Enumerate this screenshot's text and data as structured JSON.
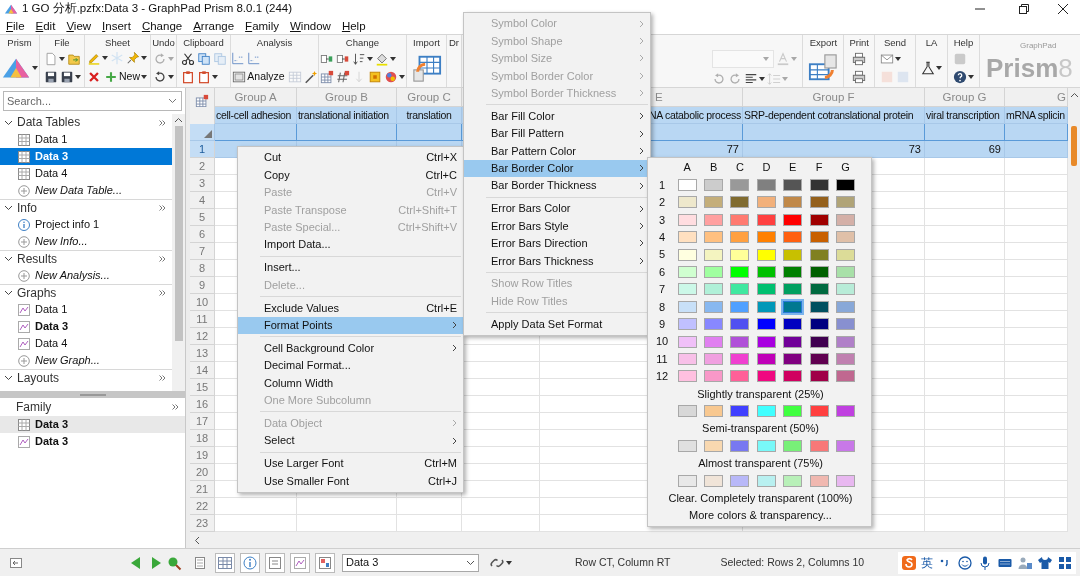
{
  "window": {
    "title": "1 GO 分析.pzfx:Data 3 - GraphPad Prism 8.0.1 (244)"
  },
  "menu_bar": [
    "File",
    "Edit",
    "View",
    "Insert",
    "Change",
    "Arrange",
    "Family",
    "Window",
    "Help"
  ],
  "ribbon": {
    "left": [
      {
        "label": "Prism",
        "rows": [
          [
            {
              "kind": "prism",
              "disabled": false,
              "has_menu": true
            }
          ]
        ]
      },
      {
        "label": "File",
        "rows": [
          [
            {
              "kind": "doc",
              "disabled": false,
              "has_menu": true
            },
            {
              "kind": "open",
              "disabled": false
            }
          ],
          [
            {
              "kind": "save",
              "disabled": false
            },
            {
              "kind": "save",
              "disabled": false,
              "has_menu": true
            }
          ]
        ]
      },
      {
        "label": "Sheet",
        "rows": [
          [
            {
              "kind": "pen",
              "disabled": false,
              "has_menu": true
            },
            {
              "kind": "snowflake",
              "disabled": true
            },
            {
              "kind": "pin",
              "disabled": false,
              "has_menu": true
            }
          ],
          [
            {
              "kind": "cross",
              "disabled": false
            },
            {
              "kind": "plus",
              "label": "New",
              "disabled": false,
              "has_menu": true
            }
          ]
        ]
      },
      {
        "label": "Undo",
        "rows": [
          [
            {
              "kind": "redo",
              "disabled": true,
              "has_menu": true
            }
          ],
          [
            {
              "kind": "undo",
              "disabled": false,
              "has_menu": true
            }
          ]
        ]
      },
      {
        "label": "Clipboard",
        "rows": [
          [
            {
              "kind": "scissors",
              "disabled": false
            },
            {
              "kind": "copy",
              "disabled": false
            },
            {
              "kind": "copy",
              "disabled": true
            }
          ],
          [
            {
              "kind": "clipboard",
              "disabled": false
            },
            {
              "kind": "clipboard",
              "disabled": false,
              "has_menu": true
            }
          ]
        ]
      },
      {
        "label": "Analysis",
        "rows": [
          [
            {
              "kind": "chartdash",
              "disabled": false
            },
            {
              "kind": "chartdash",
              "disabled": false
            }
          ],
          [
            {
              "kind": "analyze",
              "label": "Analyze",
              "disabled": false
            },
            {
              "kind": "table",
              "disabled": true
            },
            {
              "kind": "wand",
              "disabled": false
            }
          ]
        ]
      },
      {
        "label": "Change",
        "rows": [
          [
            {
              "kind": "insertcol",
              "disabled": false
            },
            {
              "kind": "insertcol2",
              "disabled": false
            },
            {
              "kind": "sort",
              "disabled": false,
              "has_menu": true
            },
            {
              "kind": "bucket",
              "disabled": false,
              "has_menu": true
            }
          ],
          [
            {
              "kind": "tablered",
              "disabled": false
            },
            {
              "kind": "hash",
              "disabled": false
            },
            {
              "kind": "numdown",
              "disabled": true
            },
            {
              "kind": "yellowsq",
              "disabled": false
            },
            {
              "kind": "palette",
              "disabled": false,
              "has_menu": true
            }
          ]
        ]
      },
      {
        "label": "Import",
        "rows": [
          [
            {
              "kind": "import",
              "disabled": false
            }
          ]
        ]
      },
      {
        "label": "Dr"
      }
    ],
    "format": {
      "rows": [
        [
          {
            "kind": "combo",
            "disabled": true
          },
          {
            "kind": "fontcolor",
            "disabled": true,
            "has_menu": true
          }
        ],
        [
          {
            "kind": "undo",
            "disabled": true
          },
          {
            "kind": "redo",
            "disabled": true
          },
          {
            "kind": "align",
            "disabled": false,
            "has_menu": true
          },
          {
            "kind": "spacing",
            "disabled": true,
            "has_menu": true
          }
        ]
      ]
    },
    "right": [
      {
        "label": "Export",
        "rows": [
          [
            {
              "kind": "export",
              "disabled": false
            }
          ]
        ]
      },
      {
        "label": "Print",
        "rows": [
          [
            {
              "kind": "printer",
              "disabled": false
            }
          ],
          [
            {
              "kind": "printer",
              "disabled": false
            }
          ]
        ]
      },
      {
        "label": "Send",
        "rows": [
          [
            {
              "kind": "mail",
              "disabled": false,
              "has_menu": true
            }
          ],
          [
            {
              "kind": "ppt",
              "disabled": true
            },
            {
              "kind": "word",
              "disabled": true
            }
          ]
        ]
      },
      {
        "label": "LA",
        "rows": [
          [
            {
              "kind": "flask",
              "disabled": false,
              "has_menu": true
            }
          ]
        ]
      },
      {
        "label": "Help",
        "rows": [
          [
            {
              "kind": "square",
              "disabled": true
            }
          ],
          [
            {
              "kind": "help",
              "disabled": false,
              "has_menu": true
            }
          ]
        ]
      }
    ],
    "brand": {
      "small": "GraphPad",
      "name": "Prism",
      "version": "8"
    }
  },
  "navigator": {
    "search_placeholder": "Search...",
    "sections": [
      {
        "title": "Data Tables",
        "expanded": true,
        "items": [
          {
            "kind": "table",
            "label": "Data 1",
            "selected": false,
            "in_family": false
          },
          {
            "kind": "table",
            "label": "Data 3",
            "selected": true,
            "in_family": true
          },
          {
            "kind": "table",
            "label": "Data 4",
            "selected": false,
            "in_family": false
          },
          {
            "kind": "new",
            "label": "New Data Table...",
            "selected": false,
            "in_family": false
          }
        ]
      },
      {
        "title": "Info",
        "expanded": true,
        "items": [
          {
            "kind": "info",
            "label": "Project info 1",
            "selected": false,
            "in_family": false
          },
          {
            "kind": "new",
            "label": "New Info...",
            "selected": false,
            "in_family": false
          }
        ]
      },
      {
        "title": "Results",
        "expanded": true,
        "items": [
          {
            "kind": "new",
            "label": "New Analysis...",
            "selected": false,
            "in_family": false
          }
        ]
      },
      {
        "title": "Graphs",
        "expanded": true,
        "items": [
          {
            "kind": "graph",
            "label": "Data 1",
            "selected": false,
            "in_family": false
          },
          {
            "kind": "graph",
            "label": "Data 3",
            "selected": false,
            "in_family": true
          },
          {
            "kind": "graph",
            "label": "Data 4",
            "selected": false,
            "in_family": false
          },
          {
            "kind": "new",
            "label": "New Graph...",
            "selected": false,
            "in_family": false
          }
        ]
      },
      {
        "title": "Layouts",
        "expanded": true
      }
    ]
  },
  "family": {
    "title": "Family",
    "items": [
      {
        "kind": "table",
        "label": "Data 3",
        "selected": true
      },
      {
        "kind": "graph",
        "label": "Data 3",
        "selected": false
      }
    ]
  },
  "sheet": {
    "columns": [
      {
        "group": "Group A",
        "title": "cell-cell adhesion"
      },
      {
        "group": "Group B",
        "title": "translational initiation"
      },
      {
        "group": "Group C",
        "title": "translation"
      },
      null,
      {
        "group": "E",
        "title": "NA catabolic process"
      },
      {
        "group": "Group F",
        "title": "SRP-dependent cotranslational protein"
      },
      {
        "group": "Group G",
        "title": "viral transcription"
      },
      {
        "group": "G",
        "title": "mRNA splicin"
      }
    ],
    "title_row_selected": true,
    "rows": [
      {
        "number": "1",
        "selected": true,
        "cells": [
          null,
          null,
          null,
          null,
          "77",
          "73",
          "69",
          null
        ]
      },
      {
        "number": "2",
        "selected": false
      },
      {
        "number": "3",
        "selected": false
      },
      {
        "number": "4",
        "selected": false
      },
      {
        "number": "5",
        "selected": false
      },
      {
        "number": "6",
        "selected": false
      },
      {
        "number": "7",
        "selected": false
      },
      {
        "number": "8",
        "selected": false
      },
      {
        "number": "9",
        "selected": false
      },
      {
        "number": "10",
        "selected": false
      },
      {
        "number": "11",
        "selected": false
      },
      {
        "number": "12",
        "selected": false
      },
      {
        "number": "13",
        "selected": false
      },
      {
        "number": "14",
        "selected": false
      },
      {
        "number": "15",
        "selected": false
      },
      {
        "number": "16",
        "selected": false
      },
      {
        "number": "17",
        "selected": false
      },
      {
        "number": "18",
        "selected": false
      },
      {
        "number": "19",
        "selected": false
      },
      {
        "number": "20",
        "selected": false
      },
      {
        "number": "21",
        "selected": false
      },
      {
        "number": "22",
        "selected": false
      },
      {
        "number": "23",
        "selected": false
      }
    ]
  },
  "context_menu": [
    {
      "kind": "item",
      "label": "Cut",
      "shortcut": "Ctrl+X",
      "disabled": false,
      "submenu": false,
      "selected": false
    },
    {
      "kind": "item",
      "label": "Copy",
      "shortcut": "Ctrl+C",
      "disabled": false,
      "submenu": false,
      "selected": false
    },
    {
      "kind": "item",
      "label": "Paste",
      "shortcut": "Ctrl+V",
      "disabled": true,
      "submenu": false,
      "selected": false
    },
    {
      "kind": "item",
      "label": "Paste Transpose",
      "shortcut": "Ctrl+Shift+T",
      "disabled": true,
      "submenu": false,
      "selected": false
    },
    {
      "kind": "item",
      "label": "Paste Special...",
      "shortcut": "Ctrl+Shift+V",
      "disabled": true,
      "submenu": false,
      "selected": false
    },
    {
      "kind": "item",
      "label": "Import Data...",
      "disabled": false,
      "submenu": false,
      "selected": false
    },
    {
      "kind": "separator"
    },
    {
      "kind": "item",
      "label": "Insert...",
      "disabled": false,
      "submenu": false,
      "selected": false
    },
    {
      "kind": "item",
      "label": "Delete...",
      "disabled": true,
      "submenu": false,
      "selected": false
    },
    {
      "kind": "separator"
    },
    {
      "kind": "item",
      "label": "Exclude Values",
      "shortcut": "Ctrl+E",
      "disabled": false,
      "submenu": false,
      "selected": false
    },
    {
      "kind": "item",
      "label": "Format Points",
      "disabled": false,
      "submenu": true,
      "selected": true
    },
    {
      "kind": "separator"
    },
    {
      "kind": "item",
      "label": "Cell Background Color",
      "disabled": false,
      "submenu": true,
      "selected": false
    },
    {
      "kind": "item",
      "label": "Decimal Format...",
      "disabled": false,
      "submenu": false,
      "selected": false
    },
    {
      "kind": "item",
      "label": "Column Width",
      "disabled": false,
      "submenu": false,
      "selected": false
    },
    {
      "kind": "item",
      "label": "One More Subcolumn",
      "disabled": true,
      "submenu": false,
      "selected": false
    },
    {
      "kind": "separator"
    },
    {
      "kind": "item",
      "label": "Data Object",
      "disabled": true,
      "submenu": true,
      "selected": false
    },
    {
      "kind": "item",
      "label": "Select",
      "disabled": false,
      "submenu": true,
      "selected": false
    },
    {
      "kind": "separator"
    },
    {
      "kind": "item",
      "label": "Use Larger Font",
      "shortcut": "Ctrl+M",
      "disabled": false,
      "submenu": false,
      "selected": false
    },
    {
      "kind": "item",
      "label": "Use Smaller Font",
      "shortcut": "Ctrl+J",
      "disabled": false,
      "submenu": false,
      "selected": false
    }
  ],
  "format_submenu": [
    {
      "kind": "item",
      "label": "Symbol Color",
      "disabled": true,
      "submenu": true,
      "selected": false
    },
    {
      "kind": "item",
      "label": "Symbol Shape",
      "disabled": true,
      "submenu": true,
      "selected": false
    },
    {
      "kind": "item",
      "label": "Symbol Size",
      "disabled": true,
      "submenu": true,
      "selected": false
    },
    {
      "kind": "item",
      "label": "Symbol Border Color",
      "disabled": true,
      "submenu": true,
      "selected": false
    },
    {
      "kind": "item",
      "label": "Symbol Border Thickness",
      "disabled": true,
      "submenu": true,
      "selected": false
    },
    {
      "kind": "separator"
    },
    {
      "kind": "item",
      "label": "Bar Fill Color",
      "disabled": false,
      "submenu": true,
      "selected": false
    },
    {
      "kind": "item",
      "label": "Bar Fill Pattern",
      "disabled": false,
      "submenu": true,
      "selected": false
    },
    {
      "kind": "item",
      "label": "Bar Pattern Color",
      "disabled": false,
      "submenu": true,
      "selected": false
    },
    {
      "kind": "item",
      "label": "Bar Border Color",
      "disabled": false,
      "submenu": true,
      "selected": true
    },
    {
      "kind": "item",
      "label": "Bar Border Thickness",
      "disabled": false,
      "submenu": true,
      "selected": false
    },
    {
      "kind": "separator"
    },
    {
      "kind": "item",
      "label": "Error Bars Color",
      "disabled": false,
      "submenu": true,
      "selected": false
    },
    {
      "kind": "item",
      "label": "Error Bars Style",
      "disabled": false,
      "submenu": true,
      "selected": false
    },
    {
      "kind": "item",
      "label": "Error Bars Direction",
      "disabled": false,
      "submenu": true,
      "selected": false
    },
    {
      "kind": "item",
      "label": "Error Bars Thickness",
      "disabled": false,
      "submenu": true,
      "selected": false
    },
    {
      "kind": "separator"
    },
    {
      "kind": "item",
      "label": "Show Row Titles",
      "disabled": true,
      "submenu": false,
      "selected": false
    },
    {
      "kind": "item",
      "label": "Hide Row Titles",
      "disabled": true,
      "submenu": false,
      "selected": false
    },
    {
      "kind": "separator"
    },
    {
      "kind": "item",
      "label": "Apply Data Set Format",
      "disabled": false,
      "submenu": false,
      "selected": false
    }
  ],
  "color_menu": {
    "columns": [
      "A",
      "B",
      "C",
      "D",
      "E",
      "F",
      "G"
    ],
    "rows": [
      {
        "label": "1",
        "swatches": [
          {
            "color": "#ffffff",
            "selected": false
          },
          {
            "color": "#cccccc",
            "selected": false
          },
          {
            "color": "#999999",
            "selected": false
          },
          {
            "color": "#808080",
            "selected": false
          },
          {
            "color": "#555555",
            "selected": false
          },
          {
            "color": "#333333",
            "selected": false
          },
          {
            "color": "#000000",
            "selected": false
          }
        ]
      },
      {
        "label": "2",
        "swatches": [
          {
            "color": "#eee8cc",
            "selected": false
          },
          {
            "color": "#c4ae7a",
            "selected": false
          },
          {
            "color": "#806b30",
            "selected": false
          },
          {
            "color": "#f2b07a",
            "selected": false
          },
          {
            "color": "#c08848",
            "selected": false
          },
          {
            "color": "#94601c",
            "selected": false
          },
          {
            "color": "#b0a478",
            "selected": false
          }
        ]
      },
      {
        "label": "3",
        "swatches": [
          {
            "color": "#ffdde0",
            "selected": false
          },
          {
            "color": "#ffa0a0",
            "selected": false
          },
          {
            "color": "#ff7a70",
            "selected": false
          },
          {
            "color": "#ff4040",
            "selected": false
          },
          {
            "color": "#ff0000",
            "selected": false
          },
          {
            "color": "#a00000",
            "selected": false
          },
          {
            "color": "#d4b0a8",
            "selected": false
          }
        ]
      },
      {
        "label": "4",
        "swatches": [
          {
            "color": "#ffe0c0",
            "selected": false
          },
          {
            "color": "#ffc080",
            "selected": false
          },
          {
            "color": "#ffa040",
            "selected": false
          },
          {
            "color": "#ff8000",
            "selected": false
          },
          {
            "color": "#ff6010",
            "selected": false
          },
          {
            "color": "#c86000",
            "selected": false
          },
          {
            "color": "#e0c0a8",
            "selected": false
          }
        ]
      },
      {
        "label": "5",
        "swatches": [
          {
            "color": "#ffffe0",
            "selected": false
          },
          {
            "color": "#f4f4c0",
            "selected": false
          },
          {
            "color": "#ffff99",
            "selected": false
          },
          {
            "color": "#ffff00",
            "selected": false
          },
          {
            "color": "#c8c000",
            "selected": false
          },
          {
            "color": "#808020",
            "selected": false
          },
          {
            "color": "#dcdc98",
            "selected": false
          }
        ]
      },
      {
        "label": "6",
        "swatches": [
          {
            "color": "#d0ffd0",
            "selected": false
          },
          {
            "color": "#a0ffa0",
            "selected": false
          },
          {
            "color": "#00ff00",
            "selected": false
          },
          {
            "color": "#00c000",
            "selected": false
          },
          {
            "color": "#008000",
            "selected": false
          },
          {
            "color": "#006000",
            "selected": false
          },
          {
            "color": "#a8e0a8",
            "selected": false
          }
        ]
      },
      {
        "label": "7",
        "swatches": [
          {
            "color": "#ccf8e8",
            "selected": false
          },
          {
            "color": "#b0f0d8",
            "selected": false
          },
          {
            "color": "#40e8a0",
            "selected": false
          },
          {
            "color": "#00c070",
            "selected": false
          },
          {
            "color": "#00a060",
            "selected": false
          },
          {
            "color": "#006a40",
            "selected": false
          },
          {
            "color": "#b8ecd8",
            "selected": false
          }
        ]
      },
      {
        "label": "8",
        "swatches": [
          {
            "color": "#c8e0f8",
            "selected": false
          },
          {
            "color": "#88b8f0",
            "selected": false
          },
          {
            "color": "#50a0ff",
            "selected": false
          },
          {
            "color": "#0098b8",
            "selected": false
          },
          {
            "color": "#007890",
            "selected": true
          },
          {
            "color": "#005060",
            "selected": false
          },
          {
            "color": "#88a8d8",
            "selected": false
          }
        ]
      },
      {
        "label": "9",
        "swatches": [
          {
            "color": "#c0c0ff",
            "selected": false
          },
          {
            "color": "#8888ff",
            "selected": false
          },
          {
            "color": "#5050f0",
            "selected": false
          },
          {
            "color": "#0000ff",
            "selected": false
          },
          {
            "color": "#0000c0",
            "selected": false
          },
          {
            "color": "#000080",
            "selected": false
          },
          {
            "color": "#8890d0",
            "selected": false
          }
        ]
      },
      {
        "label": "10",
        "swatches": [
          {
            "color": "#f0c0f8",
            "selected": false
          },
          {
            "color": "#e080f0",
            "selected": false
          },
          {
            "color": "#b050d8",
            "selected": false
          },
          {
            "color": "#a800e0",
            "selected": false
          },
          {
            "color": "#700098",
            "selected": false
          },
          {
            "color": "#400050",
            "selected": false
          },
          {
            "color": "#b080c8",
            "selected": false
          }
        ]
      },
      {
        "label": "11",
        "swatches": [
          {
            "color": "#f8c0e8",
            "selected": false
          },
          {
            "color": "#f0a0e0",
            "selected": false
          },
          {
            "color": "#f040d0",
            "selected": false
          },
          {
            "color": "#c000b8",
            "selected": false
          },
          {
            "color": "#800080",
            "selected": false
          },
          {
            "color": "#600050",
            "selected": false
          },
          {
            "color": "#c080b0",
            "selected": false
          }
        ]
      },
      {
        "label": "12",
        "swatches": [
          {
            "color": "#ffc0e0",
            "selected": false
          },
          {
            "color": "#f898c8",
            "selected": false
          },
          {
            "color": "#ff6098",
            "selected": false
          },
          {
            "color": "#f00880",
            "selected": false
          },
          {
            "color": "#d00060",
            "selected": false
          },
          {
            "color": "#a00048",
            "selected": false
          },
          {
            "color": "#c06890",
            "selected": false
          }
        ]
      }
    ],
    "transparency": [
      {
        "label": "Slightly transparent (25%)",
        "swatches": [
          {
            "color": "#d8d8d8",
            "selected": false
          },
          {
            "color": "#f8c890",
            "selected": false
          },
          {
            "color": "#4040ff",
            "selected": false
          },
          {
            "color": "#40ffff",
            "selected": false
          },
          {
            "color": "#40ff40",
            "selected": false
          },
          {
            "color": "#ff4040",
            "selected": false
          },
          {
            "color": "#c040e0",
            "selected": false
          }
        ]
      },
      {
        "label": "Semi-transparent (50%)",
        "swatches": [
          {
            "color": "#e0e0e0",
            "selected": false
          },
          {
            "color": "#f8d8b0",
            "selected": false
          },
          {
            "color": "#7878f0",
            "selected": false
          },
          {
            "color": "#78f8f8",
            "selected": false
          },
          {
            "color": "#78f078",
            "selected": false
          },
          {
            "color": "#f87878",
            "selected": false
          },
          {
            "color": "#c878e8",
            "selected": false
          }
        ]
      },
      {
        "label": "Almost transparent (75%)",
        "swatches": [
          {
            "color": "#e8e8e8",
            "selected": false
          },
          {
            "color": "#f0e4d8",
            "selected": false
          },
          {
            "color": "#b8b8f8",
            "selected": false
          },
          {
            "color": "#b8f0f0",
            "selected": false
          },
          {
            "color": "#b8f0b8",
            "selected": false
          },
          {
            "color": "#f0b8b0",
            "selected": false
          },
          {
            "color": "#e8b8f0",
            "selected": false
          }
        ]
      }
    ],
    "clear_label": "Clear. Completely transparent (100%)",
    "more_label": "More colors & transparency..."
  },
  "status_bar": {
    "sheet_select": "Data 3",
    "position": "Row CT, Column RT",
    "selection": "Selected: Rows 2, Columns 10",
    "ime": "英"
  }
}
